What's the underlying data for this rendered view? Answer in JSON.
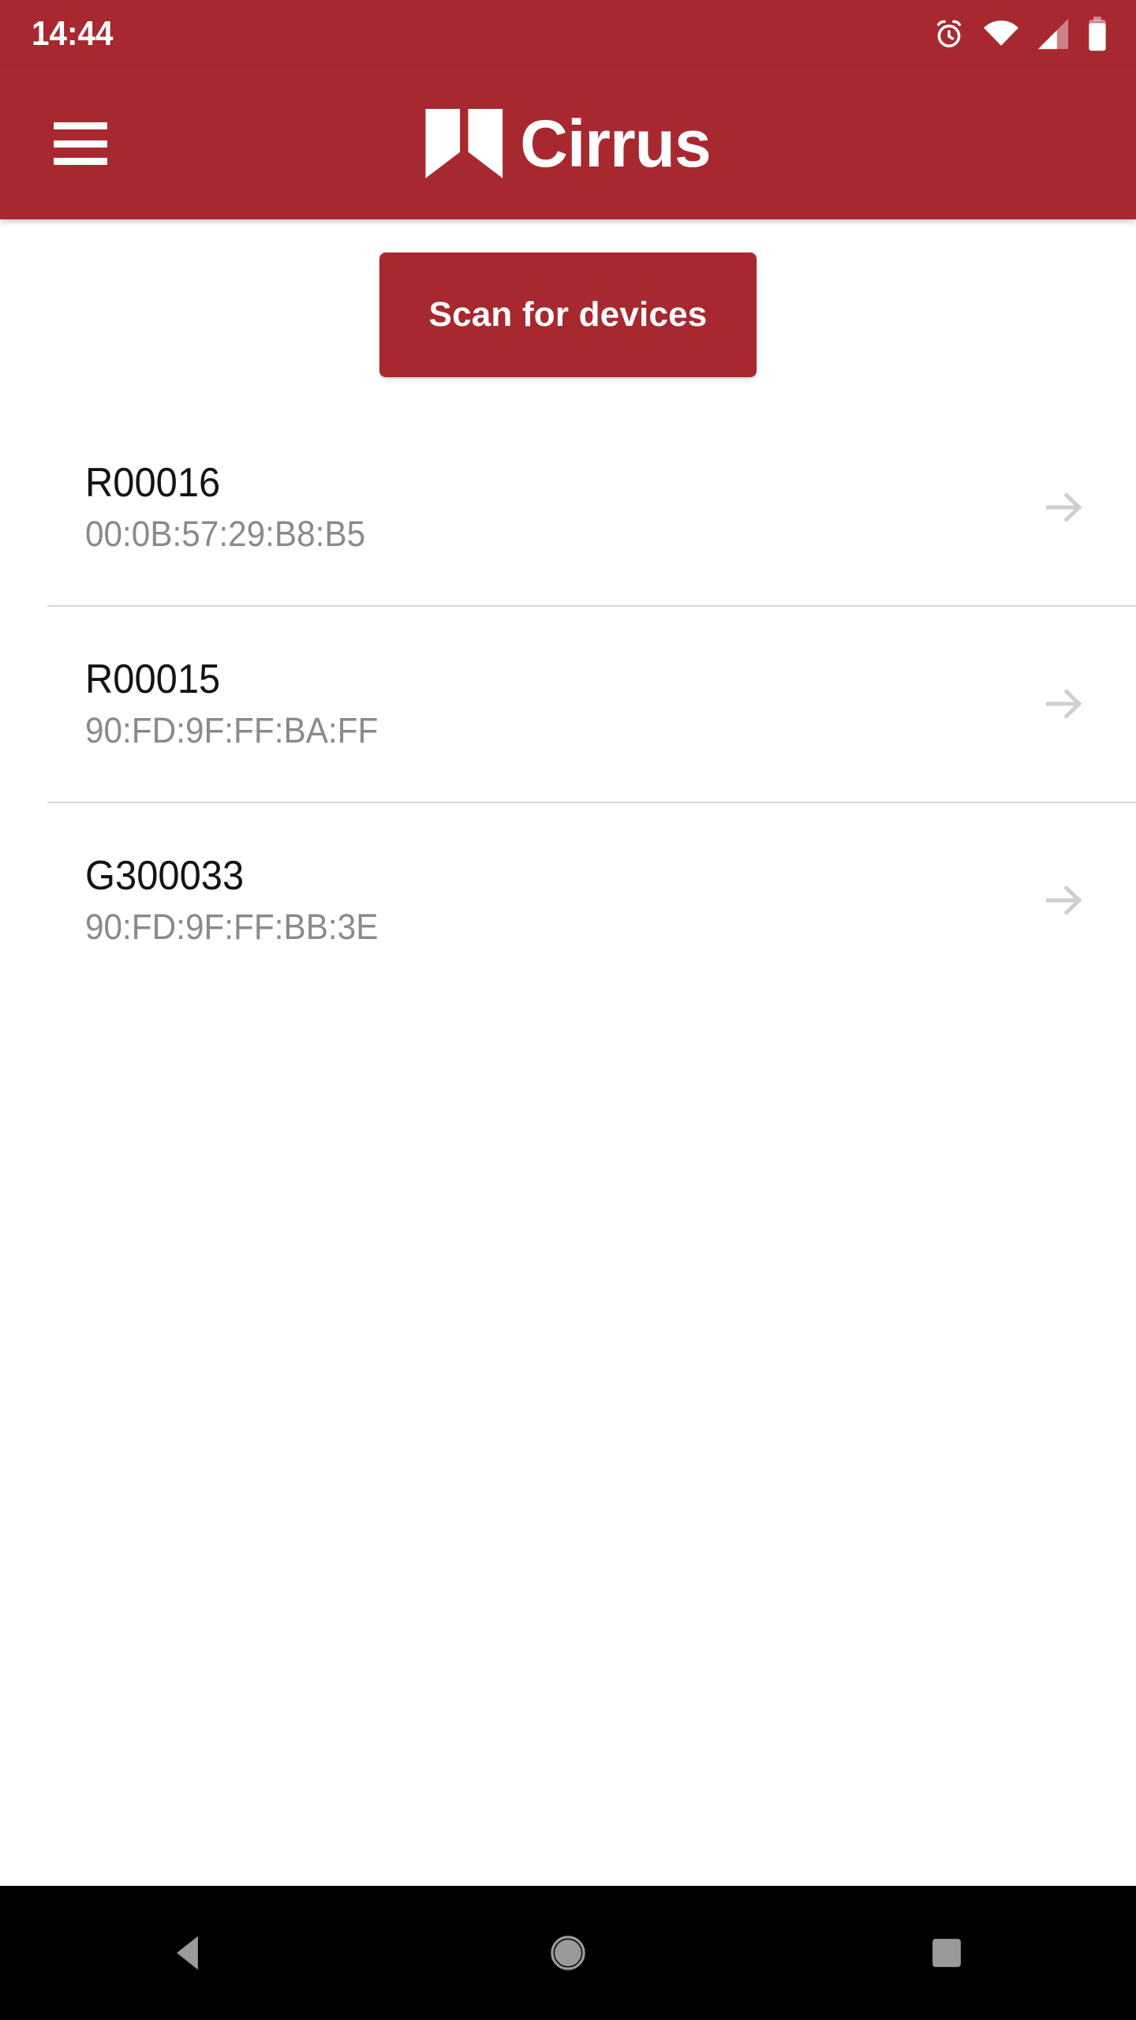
{
  "theme": {
    "brand_red": "#A82830",
    "text_primary": "#141414",
    "text_secondary": "#8a8a8a",
    "divider": "#d9d9d9",
    "navbar_bg": "#000000",
    "icon_gray": "#9a9a9a",
    "arrow_gray": "#cfcfcf"
  },
  "statusbar": {
    "time": "14:44",
    "icons": [
      {
        "name": "alarm-icon"
      },
      {
        "name": "wifi-icon"
      },
      {
        "name": "cellular-signal-icon"
      },
      {
        "name": "battery-icon"
      }
    ]
  },
  "appbar": {
    "menu_icon": "hamburger-menu-icon",
    "brand_name": "Cirrus",
    "brand_mark": "cirrus-logo-mark"
  },
  "main": {
    "scan_button_label": "Scan for devices",
    "devices": [
      {
        "name": "R00016",
        "mac": "00:0B:57:29:B8:B5"
      },
      {
        "name": "R00015",
        "mac": "90:FD:9F:FF:BA:FF"
      },
      {
        "name": "G300033",
        "mac": "90:FD:9F:FF:BB:3E"
      }
    ]
  },
  "navbar": {
    "back_label": "Back",
    "home_label": "Home",
    "recents_label": "Recent apps"
  }
}
